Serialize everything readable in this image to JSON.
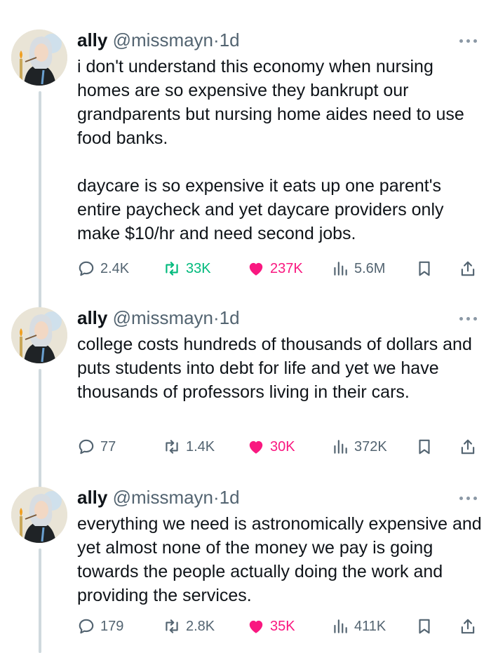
{
  "colors": {
    "text": "#0f1419",
    "secondary": "#536471",
    "retweet_green": "#00ba7c",
    "like_pink": "#f91880",
    "thread_line": "#cfd9de"
  },
  "icons": {
    "reply": "speech-bubble-icon",
    "retweet": "retweet-arrows-icon",
    "like": "heart-filled-icon",
    "views": "bar-chart-icon",
    "bookmark": "bookmark-icon",
    "share": "share-upload-icon",
    "more": "three-dots-icon"
  },
  "tweets": [
    {
      "author": {
        "name": "ally",
        "handle": "@missmayn",
        "dot": "·",
        "time": "1d"
      },
      "text": "i don't understand this economy when nursing homes are so expensive they bankrupt our grandparents but nursing home aides need to use food banks.\n\ndaycare is so expensive it eats up one parent's entire paycheck and yet daycare providers only make $10/hr and need second jobs.",
      "stats": {
        "replies": "2.4K",
        "retweets": "33K",
        "likes": "237K",
        "views": "5.6M"
      }
    },
    {
      "author": {
        "name": "ally",
        "handle": "@missmayn",
        "dot": "·",
        "time": "1d"
      },
      "text": "college costs hundreds of thousands of dollars and puts students into debt for life and yet we have thousands of professors living in their cars.",
      "stats": {
        "replies": "77",
        "retweets": "1.4K",
        "likes": "30K",
        "views": "372K"
      }
    },
    {
      "author": {
        "name": "ally",
        "handle": "@missmayn",
        "dot": "·",
        "time": "1d"
      },
      "text": "everything we need is astronomically expensive and yet almost none of the money we pay is going towards the people actually doing the work and providing the services.",
      "stats": {
        "replies": "179",
        "retweets": "2.8K",
        "likes": "35K",
        "views": "411K"
      }
    }
  ]
}
